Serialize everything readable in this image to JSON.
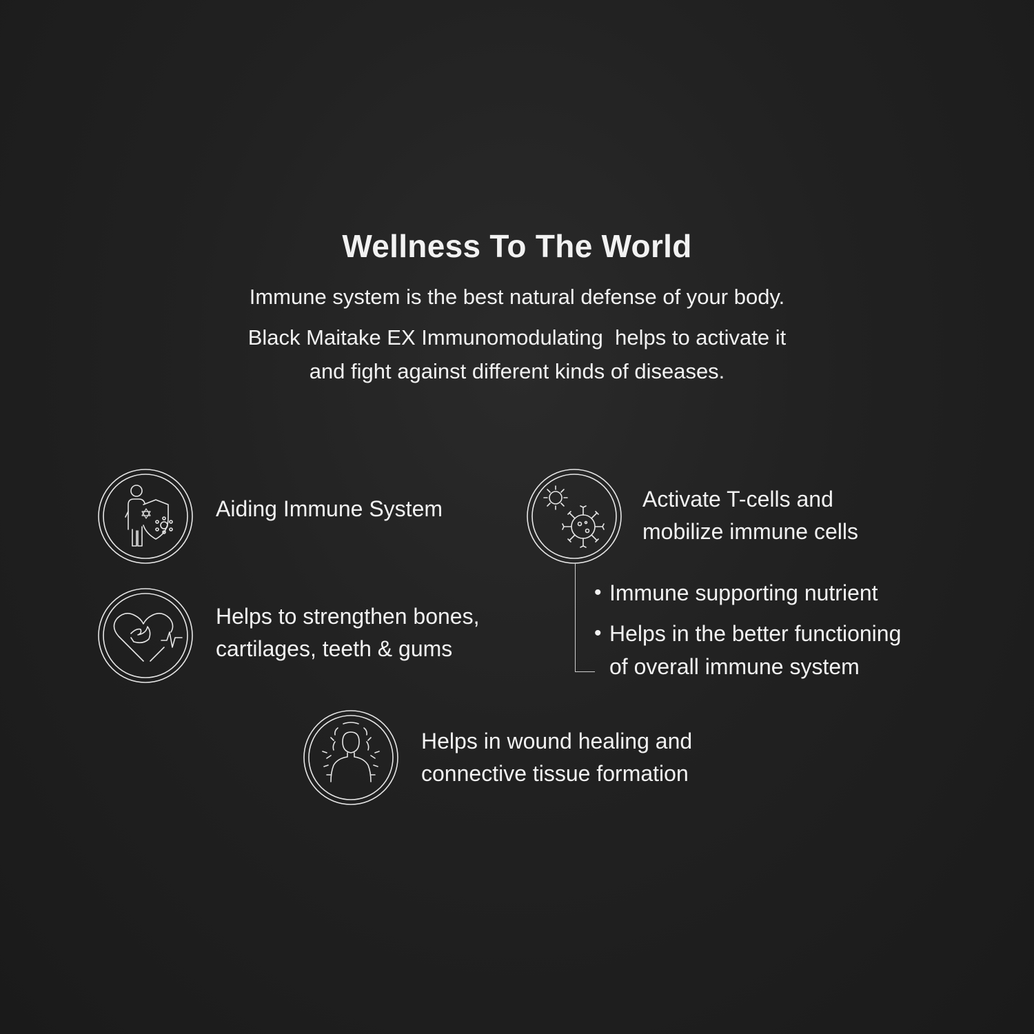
{
  "heading": "Wellness To The World",
  "intro": {
    "line1": "Immune system is the best natural defense of your body.",
    "line2": "Black Maitake EX Immunomodulating  helps to activate it",
    "line3": "and fight against different kinds of diseases."
  },
  "features": {
    "immune": {
      "icon": "person-shield-virus-icon",
      "line1": "Aiding Immune System"
    },
    "bones": {
      "icon": "heart-muscle-pulse-icon",
      "line1": "Helps to strengthen bones,",
      "line2": "cartilages, teeth & gums"
    },
    "tcells": {
      "icon": "cells-virus-icon",
      "line1": "Activate T-cells and",
      "line2": "mobilize immune cells"
    },
    "wound": {
      "icon": "person-healing-aura-icon",
      "line1": "Helps in wound healing and",
      "line2": "connective tissue formation"
    }
  },
  "tcell_bullets": {
    "item1": "Immune supporting nutrient",
    "item2_line1": "Helps in the better functioning",
    "item2_line2": "of overall immune system",
    "marker": "•"
  },
  "colors": {
    "background": "#212121",
    "text": "#f2f2f2",
    "icon_stroke": "#e6e6e6"
  }
}
